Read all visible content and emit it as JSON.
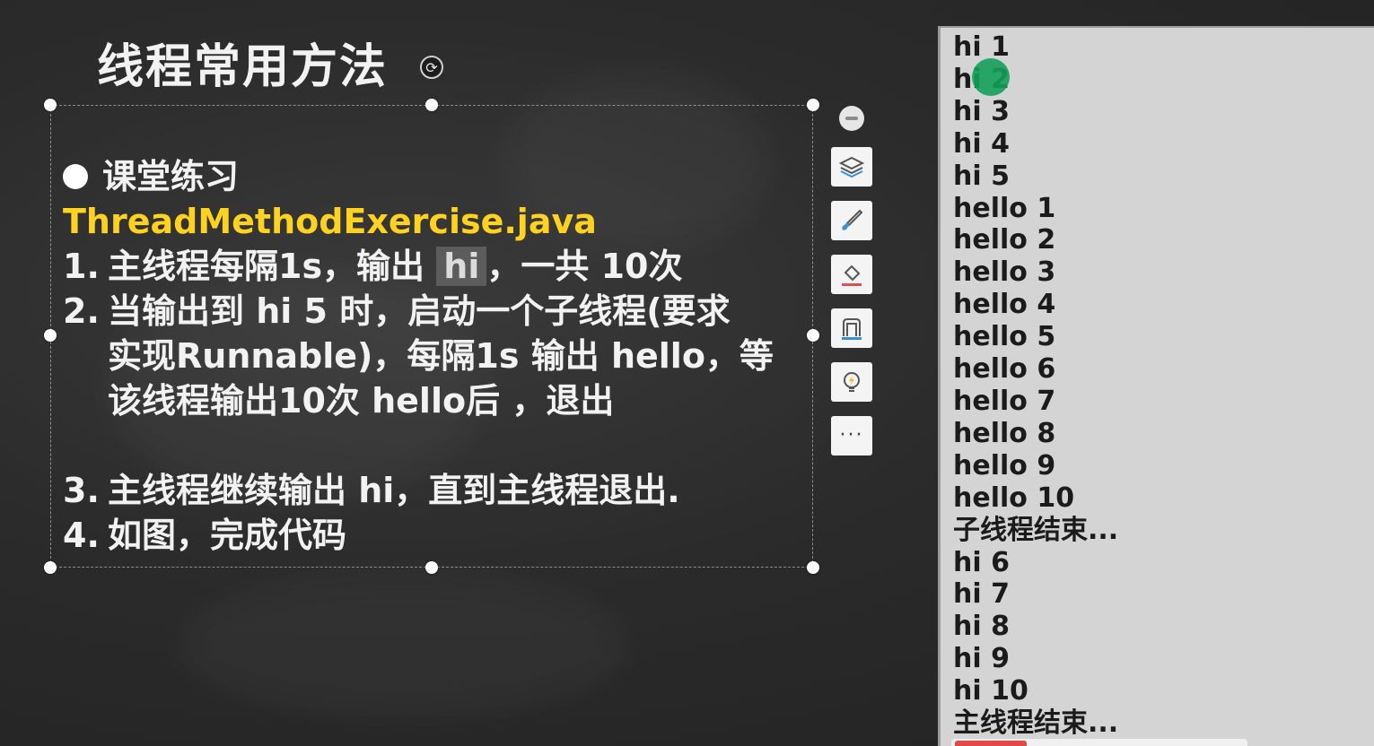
{
  "slide": {
    "title": "线程常用方法",
    "heading": "课堂练习",
    "filename": "ThreadMethodExercise.java",
    "items": [
      {
        "num": "1.",
        "pre": "主线程每隔1s，输出 ",
        "highlight": "hi",
        "post": "，一共 10次"
      },
      {
        "num": "2.",
        "text": "当输出到 hi 5 时，启动一个子线程(要求"
      },
      {
        "cont1": "实现Runnable)，每隔1s 输出 hello，等"
      },
      {
        "cont2": "该线程输出10次 hello后 ，退出"
      },
      {
        "num": "3.",
        "text": "主线程继续输出 hi，直到主线程退出."
      },
      {
        "num": "4.",
        "text": "如图，完成代码"
      }
    ]
  },
  "toolbar": {
    "more_label": "···"
  },
  "console": {
    "lines": [
      "hi 1",
      "hi 2",
      "hi 3",
      "hi 4",
      "hi 5",
      "hello 1",
      "hello 2",
      "hello 3",
      "hello 4",
      "hello 5",
      "hello 6",
      "hello 7",
      "hello 8",
      "hello 9",
      "hello 10",
      "子线程结束...",
      "hi 6",
      "hi 7",
      "hi 8",
      "hi 9",
      "hi 10",
      "主线程结束..."
    ]
  },
  "colors": {
    "filename": "#ffd21f",
    "cursor": "#14a05a",
    "console_bg": "#d4d4d4"
  }
}
